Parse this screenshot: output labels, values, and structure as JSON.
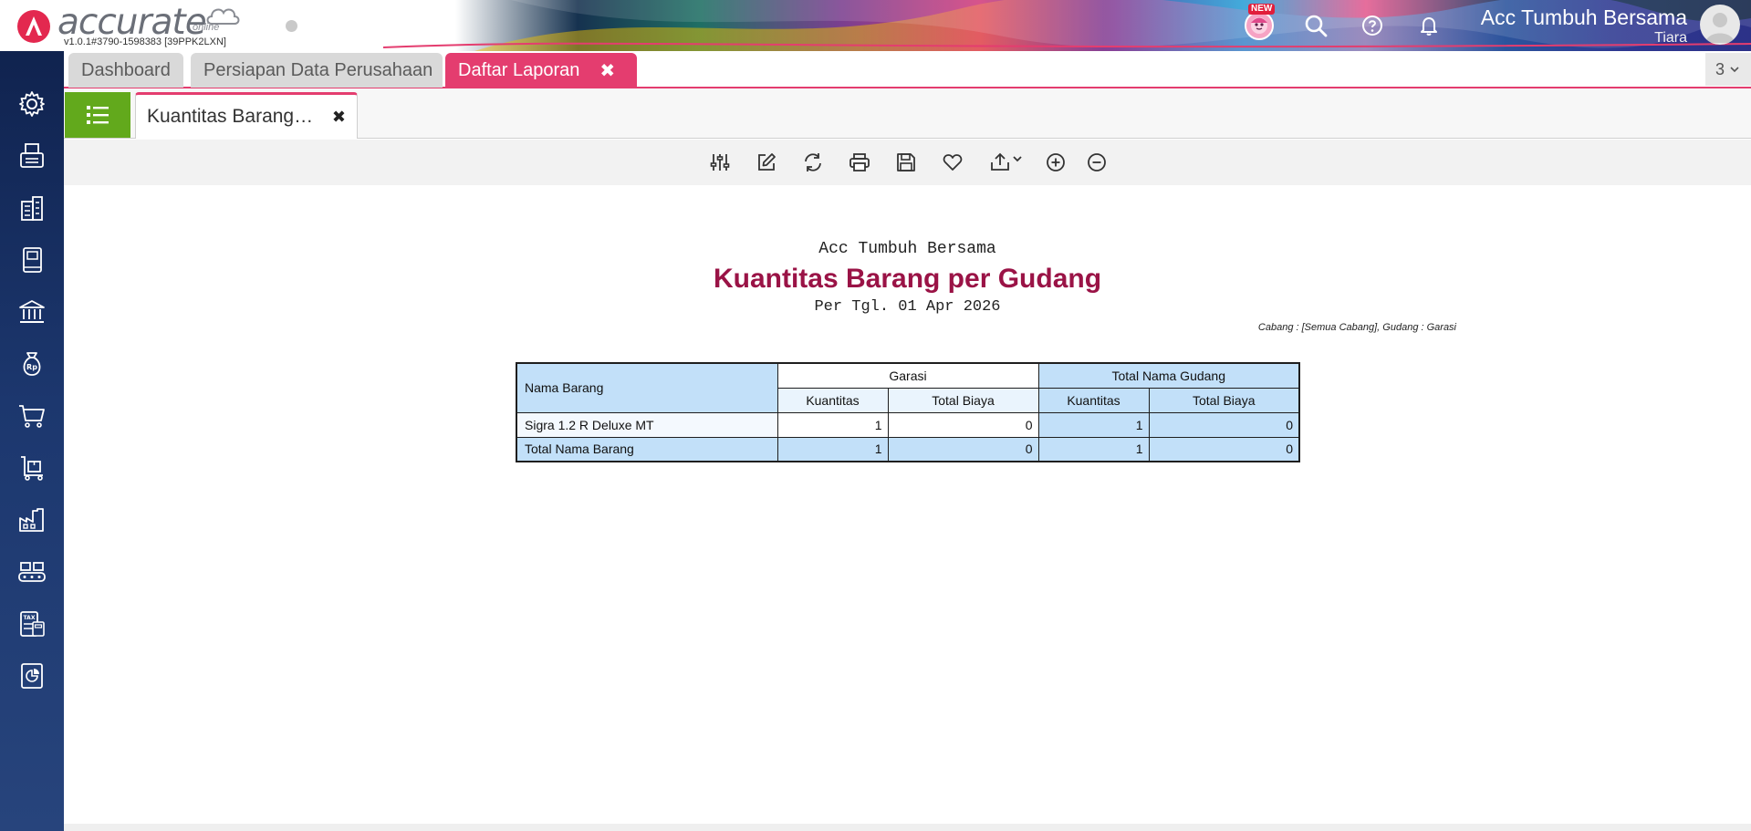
{
  "brand": {
    "word": "accurate",
    "online": "online",
    "version": "v1.0.1#3790-1598383 [39PPK2LXN]"
  },
  "header": {
    "new_badge": "NEW",
    "company": "Acc Tumbuh Bersama",
    "user": "Tiara",
    "icons": [
      "mascot-icon",
      "search-icon",
      "help-icon",
      "bell-icon",
      "avatar-icon"
    ]
  },
  "sidebar": {
    "icons": [
      "gear-icon",
      "fax-icon",
      "building-icon",
      "book-icon",
      "bank-icon",
      "money-bag-icon",
      "cart-icon",
      "trolley-icon",
      "factory-icon",
      "conveyor-icon",
      "tax-icon",
      "report-icon"
    ]
  },
  "tabs": {
    "items": [
      {
        "label": "Dashboard"
      },
      {
        "label": "Persiapan Data Perusahaan"
      },
      {
        "label": "Daftar Laporan"
      }
    ],
    "close": "✖",
    "count": "3"
  },
  "subtab": {
    "label": "Kuantitas Barang…",
    "close": "✖"
  },
  "toolbar": {
    "icons": [
      "sliders-icon",
      "edit-icon",
      "refresh-icon",
      "print-icon",
      "save-icon",
      "favorite-icon",
      "export-icon",
      "zoom-in-icon",
      "zoom-out-icon"
    ]
  },
  "report": {
    "company": "Acc Tumbuh Bersama",
    "title": "Kuantitas Barang per Gudang",
    "date": "Per Tgl. 01 Apr 2026",
    "filter": "Cabang : [Semua Cabang], Gudang : Garasi",
    "table": {
      "col_name": "Nama Barang",
      "group1": "Garasi",
      "group2": "Total Nama Gudang",
      "sub_qty": "Kuantitas",
      "sub_cost": "Total Biaya",
      "rows": [
        {
          "name": "Sigra 1.2 R Deluxe MT",
          "qty1": "1",
          "cost1": "0",
          "qty2": "1",
          "cost2": "0"
        }
      ],
      "total": {
        "name": "Total Nama Barang",
        "qty1": "1",
        "cost1": "0",
        "qty2": "1",
        "cost2": "0"
      }
    }
  },
  "colors": {
    "accent_pink": "#e43d6f",
    "title_red": "#9a1346",
    "list_green": "#62a91c",
    "sidebar_navy": "#1c376e",
    "table_blue": "#c2e0f9"
  }
}
